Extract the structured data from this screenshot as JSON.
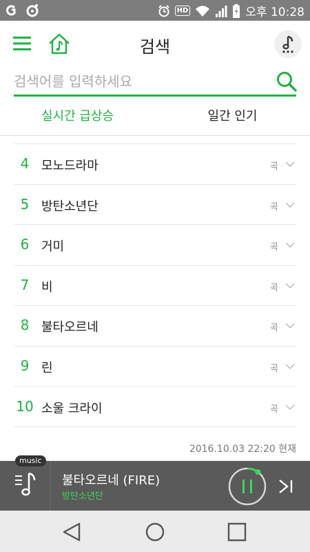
{
  "status_bar": {
    "time": "오후 10:28",
    "hd": "HD",
    "icons": [
      "carrier-g-icon",
      "camera-icon",
      "alarm-icon",
      "hd-icon",
      "wifi-icon",
      "signal-icon",
      "battery-icon"
    ]
  },
  "header": {
    "title": "검색",
    "accent_color": "#1fb240"
  },
  "search": {
    "placeholder": "검색어를 입력하세요",
    "value": ""
  },
  "tabs": [
    {
      "label": "실시간 급상승",
      "active": true
    },
    {
      "label": "일간 인기",
      "active": false
    }
  ],
  "results": [
    {
      "rank": "4",
      "name": "모노드라마",
      "type": "곡"
    },
    {
      "rank": "5",
      "name": "방탄소년단",
      "type": "곡"
    },
    {
      "rank": "6",
      "name": "거미",
      "type": "곡"
    },
    {
      "rank": "7",
      "name": "비",
      "type": "곡"
    },
    {
      "rank": "8",
      "name": "불타오르네",
      "type": "곡"
    },
    {
      "rank": "9",
      "name": "린",
      "type": "곡"
    },
    {
      "rank": "10",
      "name": "소울 크라이",
      "type": "곡"
    }
  ],
  "timestamp": "2016.10.03 22:20 현재",
  "player": {
    "badge": "music",
    "song_title": "불타오르네 (FIRE)",
    "artist": "방탄소년단",
    "progress": 0.1
  },
  "nav": [
    "back-icon",
    "home-icon",
    "recents-icon"
  ]
}
